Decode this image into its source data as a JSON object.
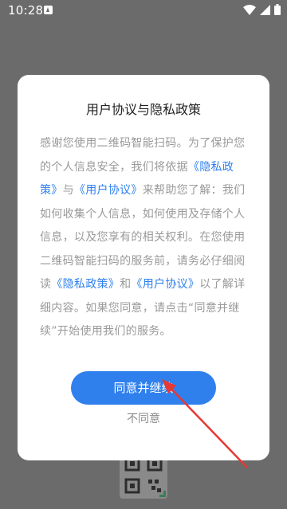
{
  "status_bar": {
    "time": "10:28",
    "icons": [
      "notification-icon",
      "wifi-icon",
      "signal-icon",
      "battery-icon"
    ]
  },
  "dialog": {
    "title": "用户协议与隐私政策",
    "body": {
      "p1": "感谢您使用二维码智能扫码。为了保护您的个人信息安全，我们将依据",
      "privacy_link": "《隐私政策》",
      "p2": "与",
      "user_link": "《用户协议》",
      "p3": "来帮助您了解：我们如何收集个人信息，如何使用及存储个人信息，以及您享有的相关权利。在您使用二维码智能扫码的服务前，请务必仔细阅读",
      "privacy_link_2": "《隐私政策》",
      "p4": "和",
      "user_link_2": "《用户协议》",
      "p5": "以了解详细内容。如果您同意，请点击“同意并继续”开始使用我们的服务。"
    },
    "agree_button": "同意并继续",
    "disagree_button": "不同意"
  },
  "colors": {
    "accent": "#2f80ed",
    "overlay": "#6b6b6b",
    "annotation_arrow": "#e53935"
  }
}
